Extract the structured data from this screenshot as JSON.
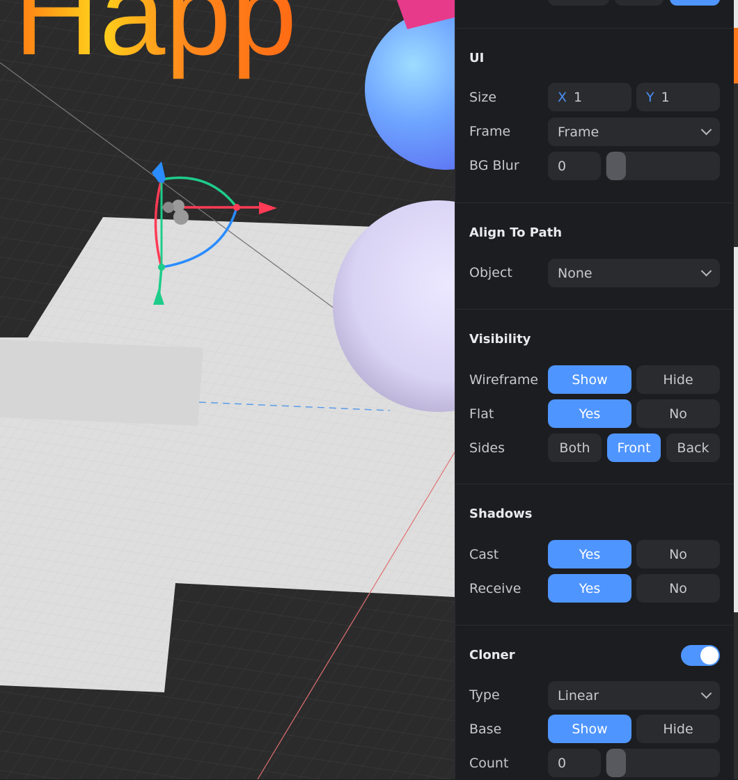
{
  "colors": {
    "accent": "#4f95ff",
    "panel_bg": "#1c1d20",
    "control_bg": "#2a2b2f"
  },
  "viewport": {
    "text_fragment": "Happ"
  },
  "ui": {
    "title": "UI",
    "size": {
      "label": "Size",
      "x_axis": "X",
      "x_value": "1",
      "y_axis": "Y",
      "y_value": "1"
    },
    "frame": {
      "label": "Frame",
      "value": "Frame"
    },
    "bg_blur": {
      "label": "BG Blur",
      "value": "0"
    }
  },
  "align_to_path": {
    "title": "Align To Path",
    "object": {
      "label": "Object",
      "value": "None"
    }
  },
  "visibility": {
    "title": "Visibility",
    "wireframe": {
      "label": "Wireframe",
      "options": [
        "Show",
        "Hide"
      ],
      "selected": "Show"
    },
    "flat": {
      "label": "Flat",
      "options": [
        "Yes",
        "No"
      ],
      "selected": "Yes"
    },
    "sides": {
      "label": "Sides",
      "options": [
        "Both",
        "Front",
        "Back"
      ],
      "selected": "Front"
    }
  },
  "shadows": {
    "title": "Shadows",
    "cast": {
      "label": "Cast",
      "options": [
        "Yes",
        "No"
      ],
      "selected": "Yes"
    },
    "receive": {
      "label": "Receive",
      "options": [
        "Yes",
        "No"
      ],
      "selected": "Yes"
    }
  },
  "cloner": {
    "title": "Cloner",
    "enabled": true,
    "type": {
      "label": "Type",
      "value": "Linear"
    },
    "base": {
      "label": "Base",
      "options": [
        "Show",
        "Hide"
      ],
      "selected": "Show"
    },
    "count": {
      "label": "Count",
      "value": "0"
    }
  }
}
